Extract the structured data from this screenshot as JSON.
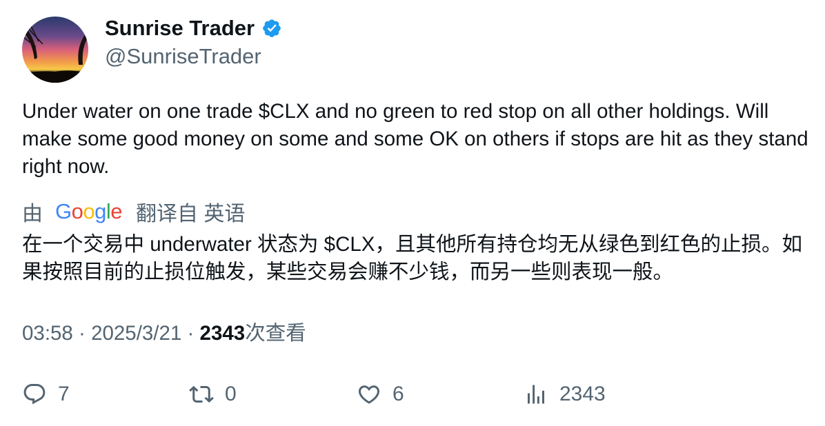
{
  "author": {
    "display_name": "Sunrise Trader",
    "handle": "@SunriseTrader",
    "verified_color": "#1d9bf0"
  },
  "tweet": {
    "text": "Under water on one trade $CLX and no green to red stop on all other holdings. Will make some good money on some and some OK on others if stops are hit as they stand right now."
  },
  "translation": {
    "prefix": "由",
    "provider_letters": [
      "G",
      "o",
      "o",
      "g",
      "l",
      "e"
    ],
    "suffix": "翻译自 英语",
    "text": "在一个交易中 underwater 状态为 $CLX，且其他所有持仓均无从绿色到红色的止损。如果按照目前的止损位触发，某些交易会赚不少钱，而另一些则表现一般。"
  },
  "meta": {
    "time": "03:58",
    "separator": "·",
    "date": "2025/3/21",
    "views_count": "2343",
    "views_label": "次查看"
  },
  "actions": {
    "replies": "7",
    "reposts": "0",
    "likes": "6",
    "views": "2343"
  },
  "icons": {
    "reply": "reply-icon",
    "repost": "repost-icon",
    "like": "heart-icon",
    "views": "bar-chart-icon",
    "verified": "verified-badge-icon"
  }
}
